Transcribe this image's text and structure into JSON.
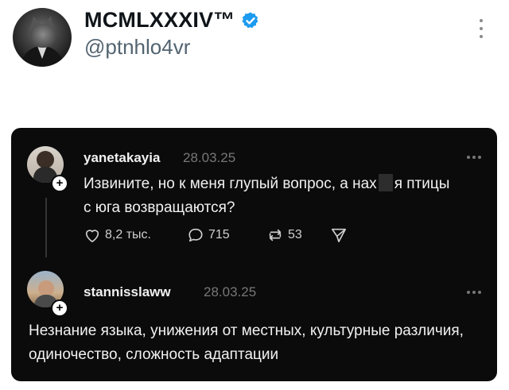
{
  "header": {
    "display_name": "MCMLXXXIV™",
    "handle": "@ptnhlo4vr",
    "verified_color": "#1d9bf0"
  },
  "embedded_post": {
    "author": "yanetakayia",
    "date": "28.03.25",
    "text_before": "Извините, но к меня глупый вопрос, а нах",
    "text_after": "я птицы",
    "text_line2": "с юга возвращаются?",
    "likes": "8,2 тыс.",
    "replies": "715",
    "reposts": "53"
  },
  "reply": {
    "author": "stannisslaww",
    "date": "28.03.25",
    "text": "Незнание языка, унижения от местных, культурные различия, одиночество, сложность адаптации"
  }
}
